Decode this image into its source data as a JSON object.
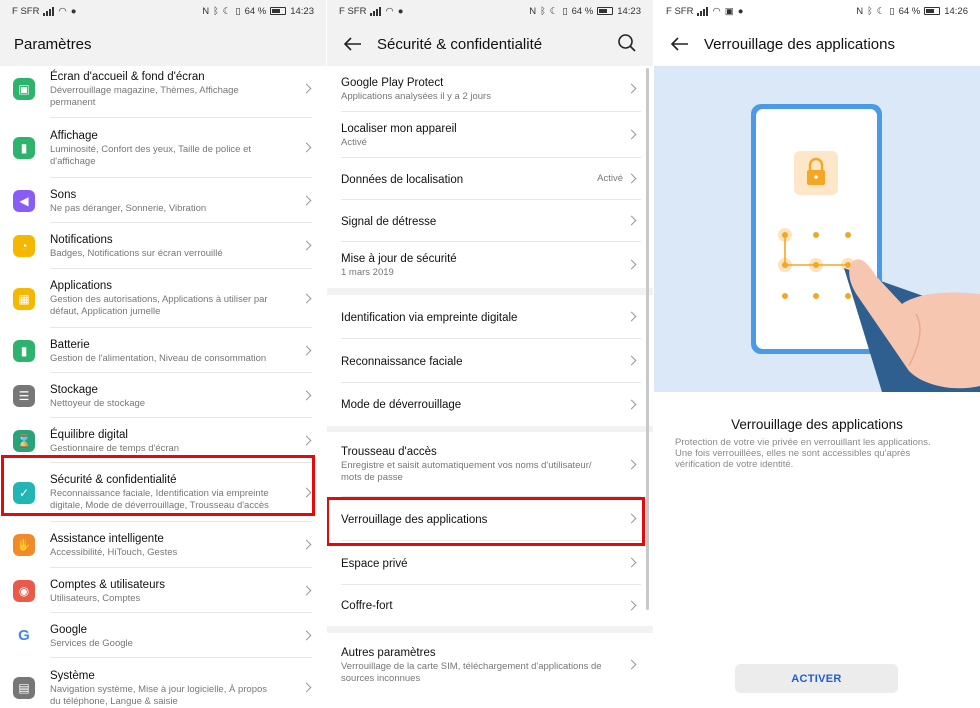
{
  "status": {
    "p1": {
      "carrier": "F SFR",
      "battery": "64 %",
      "time": "14:23"
    },
    "p2": {
      "carrier": "F SFR",
      "battery": "64 %",
      "time": "14:23"
    },
    "p3": {
      "carrier": "F SFR",
      "battery": "64 %",
      "time": "14:26"
    }
  },
  "settings": {
    "title": "Paramètres",
    "items": [
      {
        "title": "Écran d'accueil & fond d'écran",
        "sub": "Déverrouillage magazine, Thèmes, Affichage",
        "sub2": "permanent",
        "icon": "image-icon",
        "color": "#2db36b"
      },
      {
        "title": "Affichage",
        "sub": "Luminosité, Confort des yeux, Taille de police et",
        "sub2": "d'affichage",
        "icon": "display-icon",
        "color": "#2db36b"
      },
      {
        "title": "Sons",
        "sub": "Ne pas déranger, Sonnerie, Vibration",
        "sub2": "",
        "icon": "speaker-icon",
        "color": "#8a5cf6"
      },
      {
        "title": "Notifications",
        "sub": "Badges, Notifications sur écran verrouillé",
        "sub2": "",
        "icon": "bell-icon",
        "color": "#f5b800"
      },
      {
        "title": "Applications",
        "sub": "Gestion des autorisations, Applications à utiliser par",
        "sub2": "défaut, Application jumelle",
        "icon": "apps-icon",
        "color": "#f5b800"
      },
      {
        "title": "Batterie",
        "sub": "Gestion de l'alimentation, Niveau de consommation",
        "sub2": "",
        "icon": "battery-icon",
        "color": "#2db36b"
      },
      {
        "title": "Stockage",
        "sub": "Nettoyeur de stockage",
        "sub2": "",
        "icon": "storage-icon",
        "color": "#777777"
      },
      {
        "title": "Équilibre digital",
        "sub": "Gestionnaire de temps d'écran",
        "sub2": "",
        "icon": "hourglass-icon",
        "color": "#2aa37a"
      },
      {
        "title": "Sécurité & confidentialité",
        "sub": "Reconnaissance faciale, Identification via empreinte",
        "sub2": "digitale, Mode de déverrouillage, Trousseau d'accès",
        "icon": "shield-icon",
        "color": "#22b5b5"
      },
      {
        "title": "Assistance intelligente",
        "sub": "Accessibilité, HiTouch, Gestes",
        "sub2": "",
        "icon": "hand-icon",
        "color": "#f08a2a"
      },
      {
        "title": "Comptes & utilisateurs",
        "sub": "Utilisateurs, Comptes",
        "sub2": "",
        "icon": "user-icon",
        "color": "#e85a4a"
      },
      {
        "title": "Google",
        "sub": "Services de Google",
        "sub2": "",
        "icon": "google-icon",
        "color": "#ffffff"
      },
      {
        "title": "Système",
        "sub": "Navigation système, Mise à jour logicielle, À propos",
        "sub2": "du téléphone, Langue & saisie",
        "icon": "system-icon",
        "color": "#777777"
      }
    ]
  },
  "security": {
    "title": "Sécurité & confidentialité",
    "items": [
      {
        "title": "Google Play Protect",
        "sub": "Applications analysées il y a 2 jours",
        "sub2": "",
        "value": ""
      },
      {
        "title": "Localiser mon appareil",
        "sub": "Activé",
        "sub2": "",
        "value": ""
      },
      {
        "title": "Données de localisation",
        "sub": "",
        "sub2": "",
        "value": "Activé"
      },
      {
        "title": "Signal de détresse",
        "sub": "",
        "sub2": "",
        "value": ""
      },
      {
        "title": "Mise à jour de sécurité",
        "sub": "1 mars 2019",
        "sub2": "",
        "value": ""
      },
      {
        "title": "Identification via empreinte digitale",
        "sub": "",
        "sub2": "",
        "value": ""
      },
      {
        "title": "Reconnaissance faciale",
        "sub": "",
        "sub2": "",
        "value": ""
      },
      {
        "title": "Mode de déverrouillage",
        "sub": "",
        "sub2": "",
        "value": ""
      },
      {
        "title": "Trousseau d'accès",
        "sub": "Enregistre et saisit automatiquement vos noms d'utilisateur/",
        "sub2": "mots de passe",
        "value": ""
      },
      {
        "title": "Verrouillage des applications",
        "sub": "",
        "sub2": "",
        "value": ""
      },
      {
        "title": "Espace privé",
        "sub": "",
        "sub2": "",
        "value": ""
      },
      {
        "title": "Coffre-fort",
        "sub": "",
        "sub2": "",
        "value": ""
      },
      {
        "title": "Autres paramètres",
        "sub": "Verrouillage de la carte SIM, téléchargement d'applications de",
        "sub2": "sources inconnues",
        "value": ""
      }
    ]
  },
  "applock": {
    "title": "Verrouillage des applications",
    "heading": "Verrouillage des applications",
    "desc1": "Protection de votre vie privée en verrouillant les applications.",
    "desc2": "Une fois verrouillées, elles ne sont accessibles qu'après",
    "desc3": "vérification de votre identité.",
    "button": "ACTIVER"
  },
  "colors": {
    "highlight": "#e20a0a",
    "accent": "#1f5fd6"
  }
}
